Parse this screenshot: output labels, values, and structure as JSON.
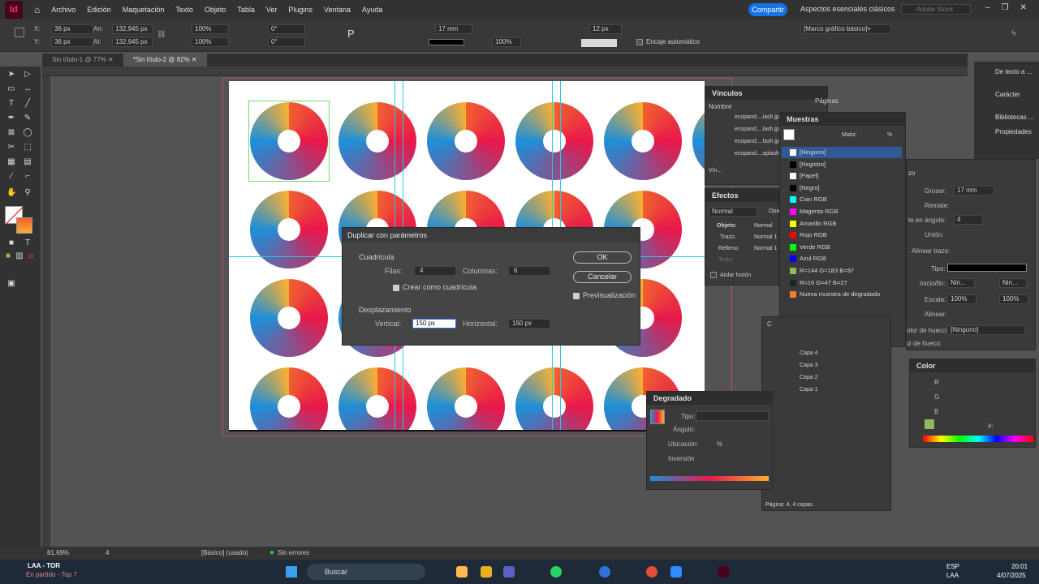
{
  "app": {
    "logo": "Id",
    "menu": [
      "Archivo",
      "Edición",
      "Maquetación",
      "Texto",
      "Objeto",
      "Tabla",
      "Ver",
      "Plugins",
      "Ventana",
      "Ayuda"
    ],
    "share": "Compartir",
    "workspace": "Aspectos esenciales clásicos",
    "search_placeholder": "Adobe Stock"
  },
  "control": {
    "x_label": "X:",
    "y_label": "Y:",
    "x": "36 px",
    "y": "36 px",
    "w_label": "An:",
    "h_label": "Al:",
    "w": "132,945 px",
    "h": "132,945 px",
    "scale_x": "100%",
    "scale_y": "100%",
    "angle": "0°",
    "shear": "0°",
    "stroke_weight": "17 mm",
    "zoom": "100%",
    "size": "12 px",
    "auto_fit": "Encaje automático",
    "frame_style": "[Marco gráfico básico]+"
  },
  "tabs": [
    {
      "label": "Sin título-1 @ 77%"
    },
    {
      "label": "*Sin título-2 @ 82%"
    }
  ],
  "dialog": {
    "title": "Duplicar con parámetros",
    "grid_section": "Cuadrícula",
    "rows_label": "Filas:",
    "rows": "4",
    "cols_label": "Columnas:",
    "cols": "6",
    "make_grid": "Crear como cuadrícula",
    "offset_section": "Desplazamiento",
    "vertical_label": "Vertical:",
    "vertical": "150 px",
    "horizontal_label": "Horizontal:",
    "horizontal": "150 px",
    "ok": "OK",
    "cancel": "Cancelar",
    "preview": "Previsualización"
  },
  "links": {
    "title": "Vínculos",
    "name_col": "Nombre",
    "items": [
      "ecopand....iash.jp",
      "ecopand....lash.jp",
      "ecopand....lash.jp",
      "ecopand....splash.jp"
    ],
    "footer": "Vín..."
  },
  "pages": {
    "title": "Páginas"
  },
  "swatches": {
    "title": "Muestras",
    "tint_label": "Matiz:",
    "pct": "%",
    "items": [
      {
        "name": "[Ninguno]",
        "color": "#ffffff"
      },
      {
        "name": "[Registro]",
        "color": "#000000"
      },
      {
        "name": "[Papel]",
        "color": "#ffffff"
      },
      {
        "name": "[Negro]",
        "color": "#000000"
      },
      {
        "name": "Cian RGB",
        "color": "#00ffff"
      },
      {
        "name": "Magenta RGB",
        "color": "#ff00ff"
      },
      {
        "name": "Amarillo RGB",
        "color": "#ffff00"
      },
      {
        "name": "Rojo RGB",
        "color": "#ff0000"
      },
      {
        "name": "Verde RGB",
        "color": "#00ff00"
      },
      {
        "name": "Azul RGB",
        "color": "#0000ff"
      },
      {
        "name": "R=144 G=183 B=97",
        "color": "#90b761"
      },
      {
        "name": "R=16 G=47 B=27",
        "color": "#102f1b"
      },
      {
        "name": "Nueva muestra de degradado",
        "color": "#f08030"
      }
    ]
  },
  "effects": {
    "title": "Efectos",
    "mode": "Normal",
    "opacity_label": "Opa",
    "object": "Objeto:",
    "object_val": "Normal",
    "stroke": "Trazo:",
    "stroke_val": "Normal 1",
    "fill": "Relleno:",
    "fill_val": "Normal 1",
    "text": "Texto:",
    "isolate": "Aislar fusión"
  },
  "stroke": {
    "weight_label": "Grosor:",
    "weight": "17 mm",
    "cap_label": "Remate:",
    "miter_label": "te en ángulo:",
    "miter": "4",
    "join_label": "Unión:",
    "align_label": "Alinear trazo:",
    "type_label": "Tipo:",
    "startend_label": "Inicio/fin:",
    "start": "Nin...",
    "end": "Nin...",
    "scale_label": "Escala:",
    "scale1": "100%",
    "scale2": "100%",
    "align2_label": "Alinear:",
    "gapcolor_label": "olor de hueco:",
    "gapcolor": "[Ninguno]",
    "gaptint_label": "iz de hueco:",
    "panel_short": "zo"
  },
  "layers": {
    "items": [
      "Capa 4",
      "Capa 3",
      "Capa 2",
      "Capa 1"
    ],
    "footer": "Página: 4, 4 capas",
    "short": "C"
  },
  "gradient": {
    "title": "Degradado",
    "type_label": "Tipo:",
    "angle_label": "Ángulo:",
    "location_label": "Ubicación:",
    "pct": "%",
    "reverse_label": "Inversión"
  },
  "color": {
    "title": "Color",
    "r": "R",
    "g": "G",
    "b": "B",
    "hash": "#:"
  },
  "rdock": [
    "De texto a ...",
    "Carácter",
    "Bibliotecas ...",
    "Propiedades"
  ],
  "status": {
    "zoom": "81,69%",
    "page": "4",
    "style": "[Básico] (usado)",
    "errors": "Sin errores"
  },
  "taskbar": {
    "team": "LAA - TOR",
    "subtitle": "En partido - Top 7",
    "search": "Buscar",
    "lang": "ESP",
    "lang2": "LAA",
    "time": "20:01",
    "date": "4/07/2025"
  }
}
